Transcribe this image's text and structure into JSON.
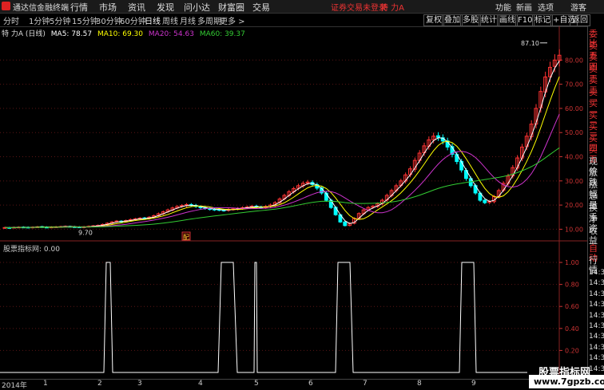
{
  "app": {
    "title": "通达信金融终端",
    "notice": "证券交易未登录",
    "stock_label": "特 力A"
  },
  "menu": [
    "行情",
    "市场",
    "资讯",
    "发现",
    "问小达",
    "财富圈",
    "交易"
  ],
  "menu_right": [
    "功能",
    "新画",
    "选项",
    "游客"
  ],
  "periods": [
    "分时",
    "1分钟",
    "5分钟",
    "15分钟",
    "30分钟",
    "60分钟",
    "日线",
    "周线",
    "月线",
    "多周期",
    "更多 >"
  ],
  "active_period": "日线",
  "tools": [
    "复权",
    "叠加",
    "多股",
    "统计",
    "画线",
    "F10",
    "标记",
    "+自选",
    "返回"
  ],
  "legend": {
    "name": "特 力A (日线)",
    "ma5": "MA5: 78.57",
    "ma10": "MA10: 69.30",
    "ma20": "MA20: 54.63",
    "ma60": "MA60: 39.37"
  },
  "colors": {
    "ma5": "#ffffff",
    "ma10": "#ffff00",
    "ma20": "#cc33cc",
    "ma60": "#33cc33",
    "up": "#ff3333",
    "down": "#00ffff"
  },
  "chart_data": [
    {
      "type": "candlestick",
      "title": "",
      "y_ticks": [
        10.0,
        20.0,
        30.0,
        40.0,
        50.0,
        60.0,
        70.0,
        80.0
      ],
      "ylim": [
        7.5,
        90
      ],
      "annotations": [
        {
          "text": "87.10",
          "value": 87.1
        },
        {
          "text": "9.70",
          "value": 9.7
        }
      ],
      "marker_text": "配",
      "series_close": [
        10.7,
        10.6,
        10.8,
        10.9,
        10.8,
        10.7,
        10.9,
        11.0,
        10.9,
        10.8,
        10.9,
        11.0,
        11.1,
        11.2,
        11.0,
        10.9,
        10.8,
        11.0,
        11.2,
        11.4,
        11.6,
        12.0,
        12.5,
        13.0,
        13.4,
        13.2,
        13.6,
        14.0,
        14.3,
        14.6,
        14.4,
        15.0,
        15.6,
        16.4,
        17.2,
        18.0,
        18.8,
        19.4,
        19.8,
        20.2,
        19.8,
        19.4,
        18.9,
        18.6,
        18.3,
        18.1,
        18.0,
        17.8,
        18.2,
        18.4,
        18.6,
        18.9,
        19.2,
        19.5,
        19.3,
        19.0,
        19.4,
        20.0,
        21.0,
        22.5,
        24.0,
        25.5,
        26.8,
        28.0,
        29.0,
        29.5,
        28.5,
        27.0,
        25.0,
        22.0,
        19.0,
        16.0,
        13.0,
        11.5,
        12.5,
        14.5,
        16.5,
        18.0,
        19.0,
        19.5,
        20.5,
        22.0,
        24.0,
        26.0,
        28.0,
        30.0,
        32.5,
        35.0,
        38.5,
        41.5,
        44.5,
        47.0,
        48.5,
        48.0,
        46.5,
        44.0,
        41.0,
        38.0,
        34.5,
        31.0,
        28.0,
        25.0,
        22.0,
        21.0,
        21.5,
        23.5,
        26.0,
        29.0,
        32.0,
        35.5,
        39.5,
        44.0,
        48.5,
        53.5,
        60.0,
        67.0,
        73.0,
        77.0,
        80.0,
        82.0
      ],
      "series": [
        {
          "name": "MA5",
          "value": 78.57
        },
        {
          "name": "MA10",
          "value": 69.3
        },
        {
          "name": "MA20",
          "value": 54.63
        },
        {
          "name": "MA60",
          "value": 39.37
        }
      ]
    },
    {
      "type": "line",
      "title": "股票指标网",
      "value_text": ": 0.00",
      "y_ticks": [
        1.0,
        0.8,
        0.6,
        0.4,
        0.2
      ],
      "ylim": [
        0,
        1.08
      ],
      "x": [
        0,
        130,
        133,
        138,
        141,
        273,
        277,
        292,
        297,
        318,
        319,
        321,
        322,
        420,
        423,
        438,
        442,
        575,
        578,
        593,
        596,
        660
      ],
      "y": [
        0,
        0,
        1,
        1,
        0,
        0,
        1,
        1,
        0,
        0,
        1,
        1,
        0,
        0,
        1,
        1,
        0,
        0,
        1,
        1,
        0,
        0
      ]
    }
  ],
  "dates": [
    {
      "text": "2014年",
      "pos": 0
    },
    {
      "text": "1",
      "pos": 1
    },
    {
      "text": "2",
      "pos": 2
    },
    {
      "text": "3",
      "pos": 3
    },
    {
      "text": "4",
      "pos": 4
    },
    {
      "text": "5",
      "pos": 5
    },
    {
      "text": "6",
      "pos": 6
    },
    {
      "text": "7",
      "pos": 7
    },
    {
      "text": "8",
      "pos": 8
    },
    {
      "text": "9",
      "pos": 9
    }
  ],
  "side_labels": [
    "委比",
    "卖五",
    "卖四",
    "卖三",
    "卖二",
    "卖一",
    "买一",
    "买二",
    "买三",
    "买四",
    "买五",
    "现价",
    "涨跌",
    "涨幅",
    "总量",
    "换手",
    "净资",
    "收益"
  ],
  "side_bottom": {
    "auto": "自动",
    "quote": "行情",
    "times": [
      "14:34",
      "14:35",
      "14:35",
      "14:35",
      "14:35",
      "14:35",
      "14:35",
      "14:35",
      "14:35",
      "14:35",
      "14:35"
    ]
  },
  "watermark": {
    "line1": "股票指标网",
    "line2": "www.7gpzb.com"
  }
}
